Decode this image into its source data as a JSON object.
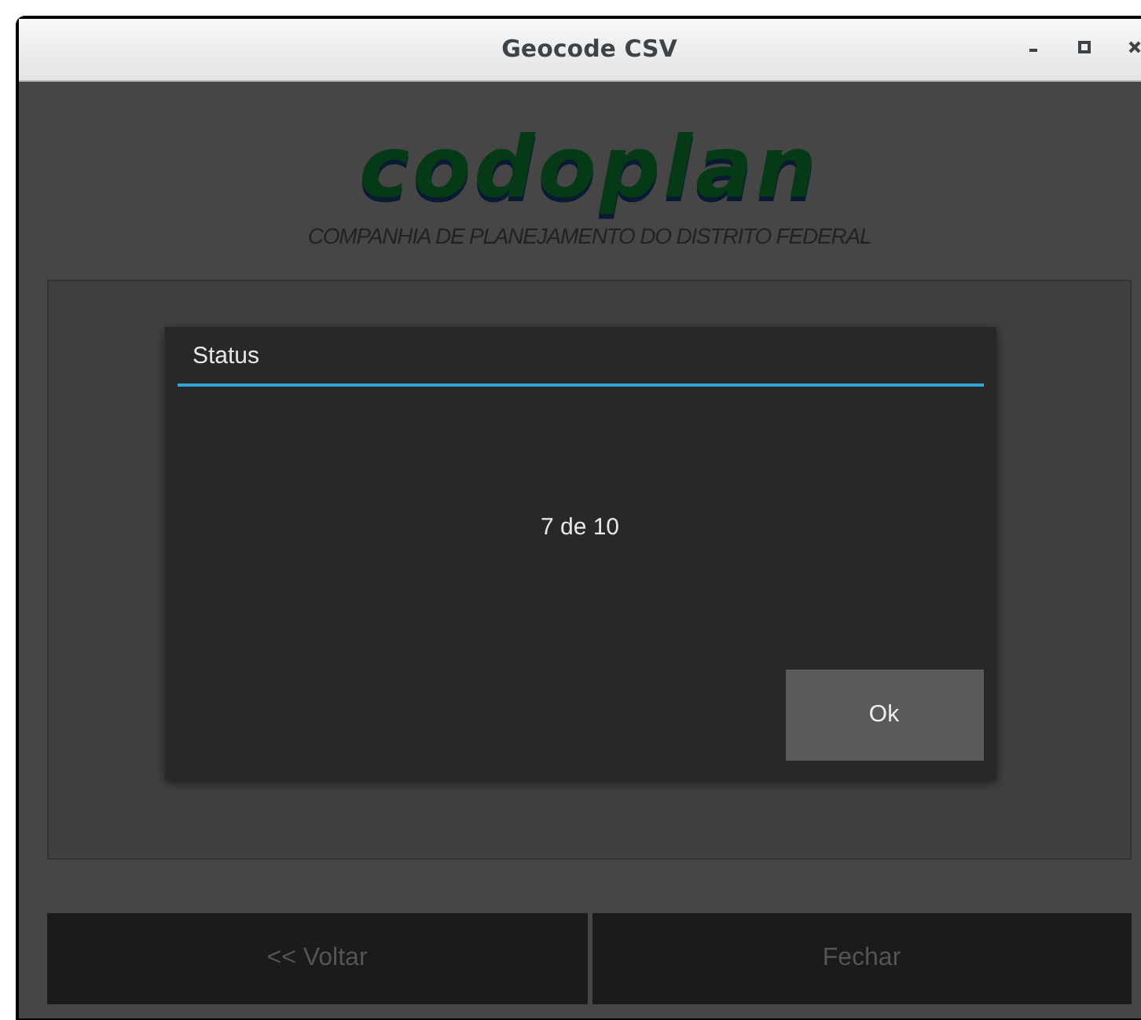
{
  "window": {
    "title": "Geocode CSV"
  },
  "logo": {
    "wordmark": "codoplan",
    "subtitle": "COMPANHIA DE PLANEJAMENTO DO DISTRITO FEDERAL"
  },
  "dialog": {
    "title": "Status",
    "message": "7 de 10",
    "button": "Ok"
  },
  "buttons": [
    {
      "label": "<< Voltar",
      "disabled": true
    },
    {
      "label": "Fechar",
      "disabled": true
    }
  ]
}
